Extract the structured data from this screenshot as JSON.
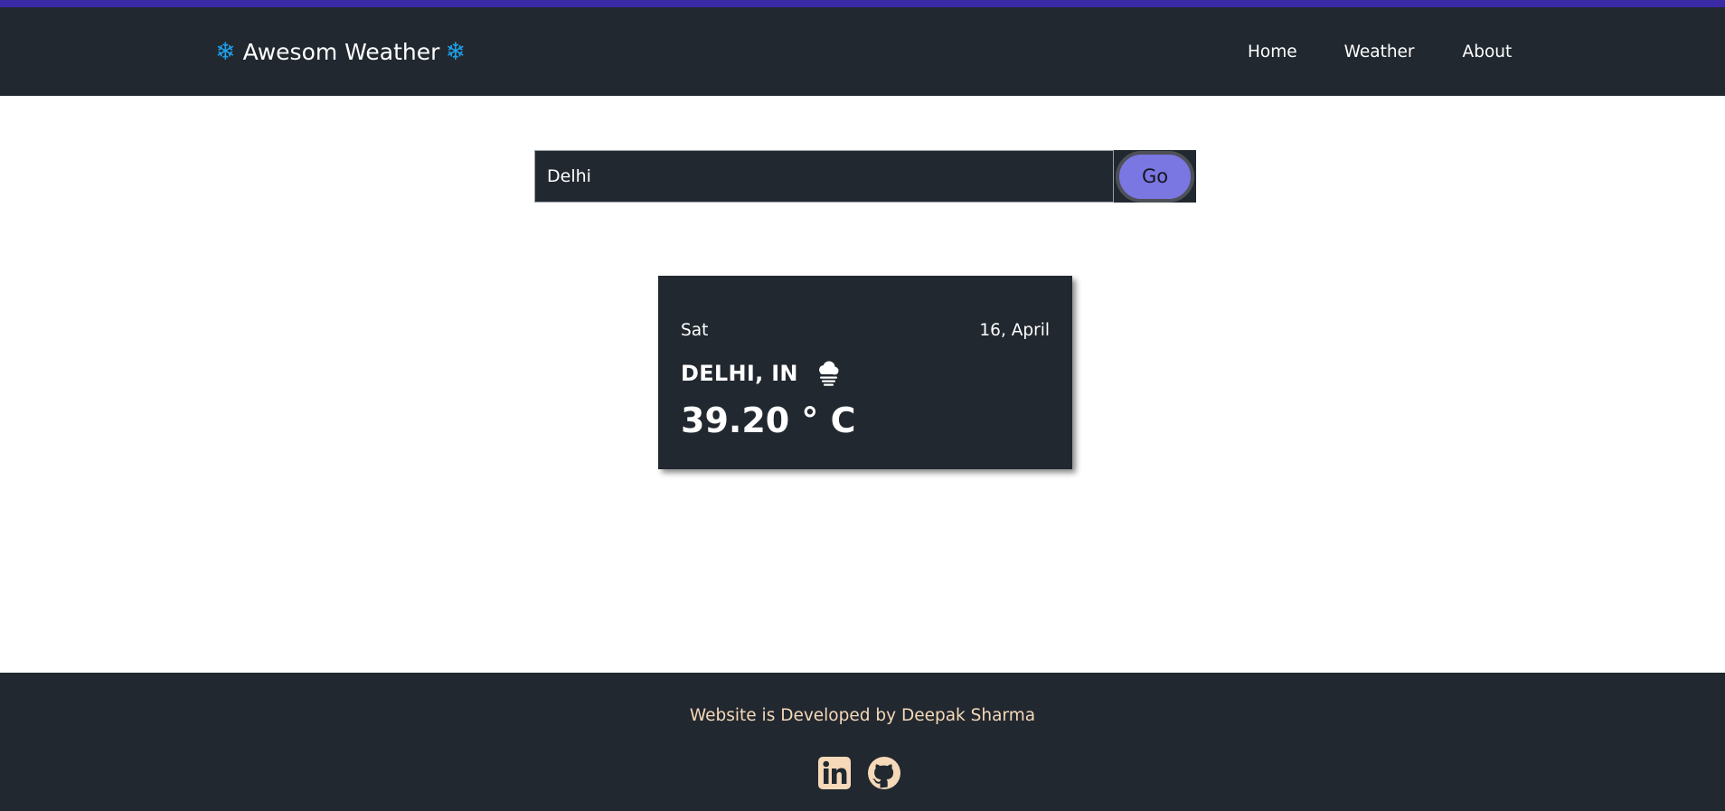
{
  "brand": {
    "title": "Awesom Weather",
    "icon_left": "snowflake-icon",
    "icon_right": "snowflake-icon",
    "icon_char": "❄",
    "icon_color": "#1ea0ea"
  },
  "nav": {
    "items": [
      {
        "label": "Home"
      },
      {
        "label": "Weather"
      },
      {
        "label": "About"
      }
    ]
  },
  "search": {
    "value": "Delhi",
    "button_label": "Go"
  },
  "card": {
    "day": "Sat",
    "date": "16, April",
    "city": "DELHI, IN",
    "weather_icon": "cloud-fog-icon",
    "temperature": "39.20 ° C"
  },
  "footer": {
    "credit": "Website is Developed by Deepak Sharma",
    "socials": [
      {
        "icon": "linkedin-icon"
      },
      {
        "icon": "github-icon"
      }
    ]
  },
  "colors": {
    "top_accent": "#3a2aa6",
    "dark_bg": "#212830",
    "go_button": "#7a76e2",
    "footer_text": "#f6d9b8"
  }
}
